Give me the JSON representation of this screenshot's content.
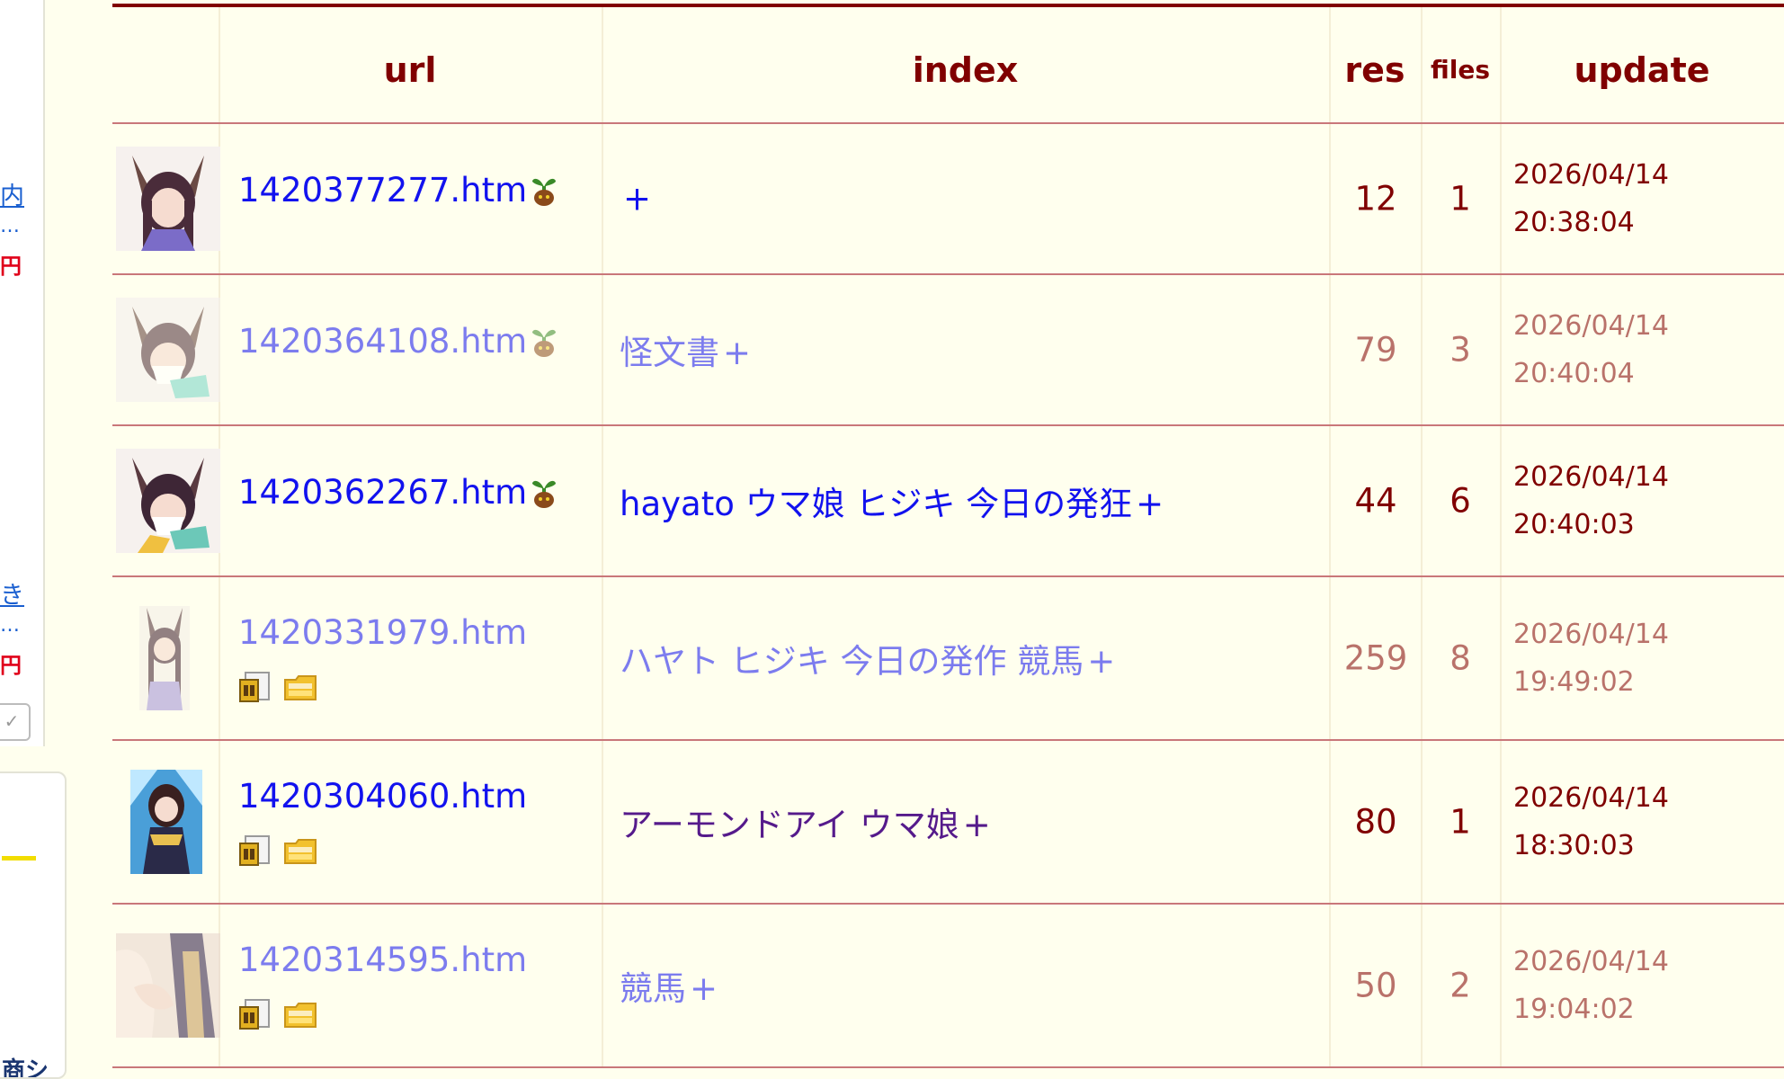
{
  "sidebar": {
    "links": [
      {
        "text": "内",
        "sub": "…",
        "price": "円"
      },
      {
        "text": "き",
        "sub": "…",
        "price": "円"
      }
    ],
    "check_icon": "check-icon",
    "bottom_text": "商シ"
  },
  "table": {
    "headers": {
      "url": "url",
      "index": "index",
      "res": "res",
      "files": "files",
      "update": "update"
    },
    "rows": [
      {
        "url": "1420377277.htm",
        "index": "",
        "plus": "+",
        "res": "12",
        "files": "1",
        "date": "2026/04/14",
        "time": "20:38:04"
      },
      {
        "url": "1420364108.htm",
        "index": "怪文書",
        "plus": "+",
        "res": "79",
        "files": "3",
        "date": "2026/04/14",
        "time": "20:40:04"
      },
      {
        "url": "1420362267.htm",
        "index": "hayato ウマ娘 ヒジキ 今日の発狂",
        "plus": "+",
        "res": "44",
        "files": "6",
        "date": "2026/04/14",
        "time": "20:40:03"
      },
      {
        "url": "1420331979.htm",
        "index": "ハヤト ヒジキ 今日の発作 競馬",
        "plus": "+",
        "res": "259",
        "files": "8",
        "date": "2026/04/14",
        "time": "19:49:02"
      },
      {
        "url": "1420304060.htm",
        "index": "アーモンドアイ ウマ娘",
        "plus": "+",
        "res": "80",
        "files": "1",
        "date": "2026/04/14",
        "time": "18:30:03"
      },
      {
        "url": "1420314595.htm",
        "index": "競馬",
        "plus": "+",
        "res": "50",
        "files": "2",
        "date": "2026/04/14",
        "time": "19:04:02"
      }
    ]
  },
  "icons": {
    "sprout": "sprout-icon",
    "image_file": "image-file-icon",
    "archive_folder": "zip-folder-icon"
  },
  "colors": {
    "background": "#ffffee",
    "header": "#800000",
    "link": "#1212ee",
    "visited": "#551a8b",
    "divider": "#c9777a"
  }
}
